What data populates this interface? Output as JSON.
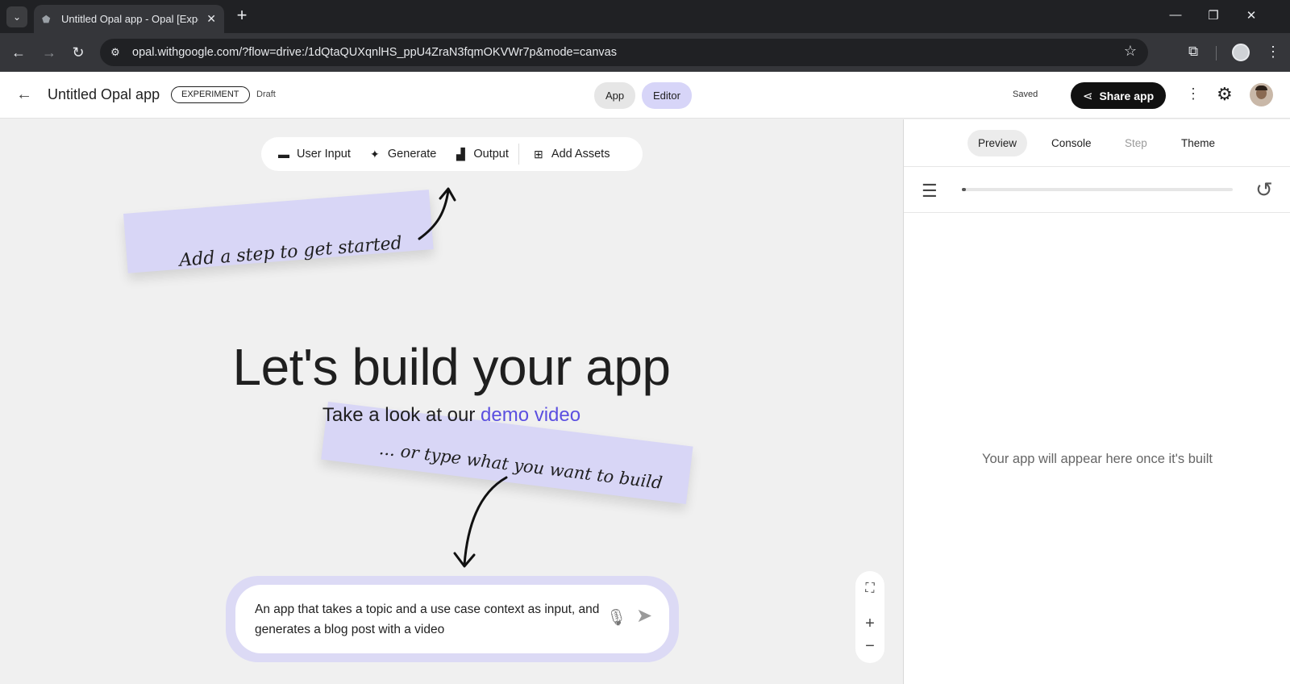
{
  "browser": {
    "tab_title": "Untitled Opal app - Opal [Exper",
    "url": "opal.withgoogle.com/?flow=drive:/1dQtaQUXqnlHS_ppU4ZraN3fqmOKVWr7p&mode=canvas"
  },
  "header": {
    "app_title": "Untitled Opal app",
    "badge": "EXPERIMENT",
    "status": "Draft",
    "mode_tabs": [
      "App",
      "Editor"
    ],
    "active_mode": "Editor",
    "save_status": "Saved",
    "share_label": "Share app"
  },
  "step_bar": {
    "items": [
      {
        "label": "User Input",
        "icon": "user-input-icon"
      },
      {
        "label": "Generate",
        "icon": "sparkle-icon"
      },
      {
        "label": "Output",
        "icon": "output-chart-icon"
      },
      {
        "label": "Add Assets",
        "icon": "add-box-icon"
      }
    ]
  },
  "canvas": {
    "note_top": "Add a step to get started",
    "headline": "Let's build your app",
    "subline_prefix": "Take a look at our ",
    "subline_link": "demo video",
    "note_bottom": "... or type what you want to build",
    "prompt_text": "An app that takes a topic and a use case context as input, and generates a blog post with a video"
  },
  "right_panel": {
    "tabs": [
      {
        "label": "Preview",
        "state": "active"
      },
      {
        "label": "Console",
        "state": "normal"
      },
      {
        "label": "Step",
        "state": "disabled"
      },
      {
        "label": "Theme",
        "state": "normal"
      }
    ],
    "progress": 0.01,
    "empty_message": "Your app will appear here once it's built"
  },
  "colors": {
    "accent_lavender": "#d8d6f6",
    "link": "#5b4fe0",
    "share_button": "#111111"
  }
}
